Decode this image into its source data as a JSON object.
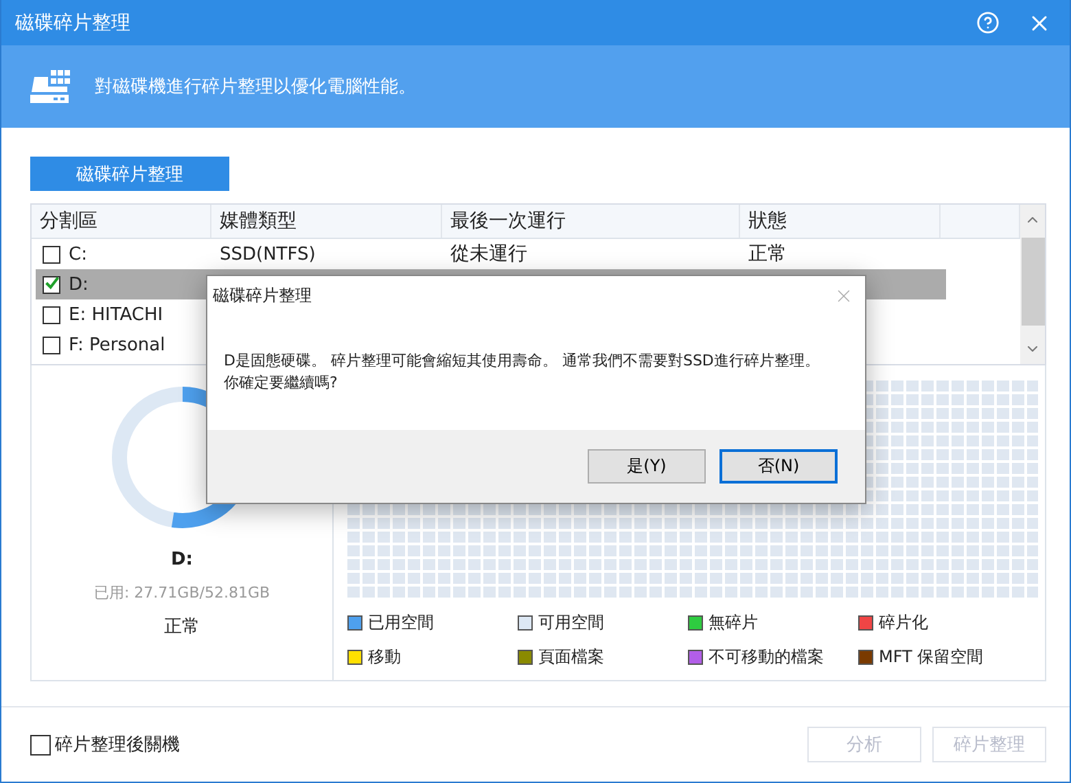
{
  "window": {
    "title": "磁碟碎片整理"
  },
  "header": {
    "text": "對磁碟機進行碎片整理以優化電腦性能。"
  },
  "top_button": "磁碟碎片整理",
  "table": {
    "columns": [
      "分割區",
      "媒體類型",
      "最後一次運行",
      "狀態"
    ],
    "rows": [
      {
        "partition": "C:",
        "media": "SSD(NTFS)",
        "last_run": "從未運行",
        "status": "正常",
        "checked": false,
        "selected": false
      },
      {
        "partition": "D:",
        "checked": true,
        "selected": true
      },
      {
        "partition": "E:  HITACHI",
        "checked": false,
        "selected": false
      },
      {
        "partition": "F:  Personal",
        "checked": false,
        "selected": false
      }
    ]
  },
  "drive_panel": {
    "name": "D:",
    "level": 0.525,
    "usage": "已用: 27.71GB/52.81GB",
    "status": "正常"
  },
  "legend": [
    {
      "label": "已用空間",
      "color": "#4ea0ee"
    },
    {
      "label": "可用空間",
      "color": "#dde8f4"
    },
    {
      "label": "無碎片",
      "color": "#2ecc40"
    },
    {
      "label": "碎片化",
      "color": "#f04545"
    },
    {
      "label": "移動",
      "color": "#ffe000"
    },
    {
      "label": "頁面檔案",
      "color": "#8a8a00"
    },
    {
      "label": "不可移動的檔案",
      "color": "#b25ee8"
    },
    {
      "label": "MFT 保留空間",
      "color": "#7a3a00"
    }
  ],
  "footer": {
    "shutdown": {
      "label": "碎片整理後關機",
      "checked": false
    },
    "buttons": [
      {
        "label": "分析",
        "disabled": true
      },
      {
        "label": "碎片整理",
        "disabled": true
      }
    ]
  },
  "dialog": {
    "title": "磁碟碎片整理",
    "lines": [
      "D是固態硬碟。 碎片整理可能會縮短其使用壽命。 通常我們不需要對SSD進行碎片整理。",
      "你確定要繼續嗎?"
    ],
    "buttons": [
      {
        "label": "是(Y)",
        "focused": false
      },
      {
        "label": "否(N)",
        "focused": true
      }
    ]
  }
}
